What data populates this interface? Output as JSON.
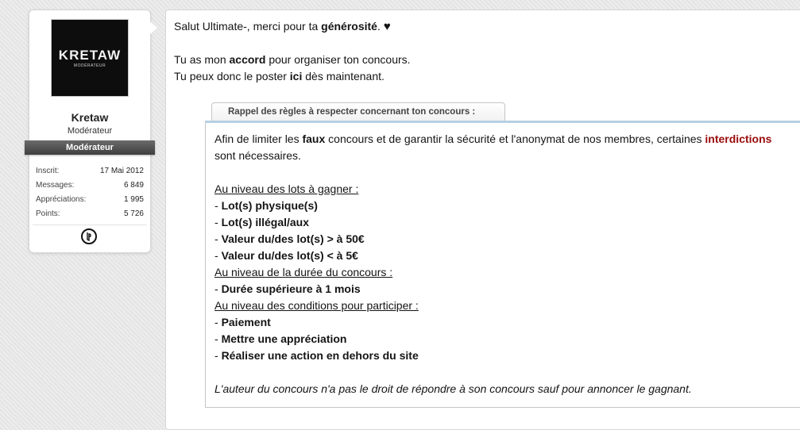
{
  "user": {
    "avatar_logo": "KRETAW",
    "avatar_sub": "MODÉRATEUR",
    "username": "Kretaw",
    "title": "Modérateur",
    "rank": "Modérateur",
    "stats": [
      {
        "label": "Inscrit:",
        "value": "17 Mai 2012"
      },
      {
        "label": "Messages:",
        "value": "6 849"
      },
      {
        "label": "Appréciations:",
        "value": "1 995"
      },
      {
        "label": "Points:",
        "value": "5 726"
      }
    ],
    "platform_icon": "playstation-icon"
  },
  "message": {
    "line1_a": "Salut Ultimate-, merci pour ta ",
    "line1_b": "générosité",
    "line1_c": ".",
    "heart": "♥",
    "line2_a": "Tu as mon ",
    "line2_b": "accord",
    "line2_c": " pour organiser ton concours.",
    "line3_a": "Tu peux donc le poster ",
    "line3_b": "ici",
    "line3_c": " dès maintenant."
  },
  "rules": {
    "tab_label": "Rappel des règles à respecter concernant ton concours :",
    "intro_a": "Afin de limiter les ",
    "intro_b": "faux",
    "intro_c": " concours et de garantir la sécurité et l'anonymat de nos membres, certaines ",
    "intro_d": "interdictions",
    "intro_e": "sont nécessaires.",
    "section_lots": "Au niveau des lots à gagner :",
    "lots": [
      "Lot(s) physique(s)",
      "Lot(s) illégal/aux",
      "Valeur du/des lot(s) > à 50€",
      "Valeur du/des lot(s) < à 5€"
    ],
    "section_duree": "Au niveau de la durée du concours :",
    "duree": [
      "Durée supérieure à 1 mois"
    ],
    "section_conditions": "Au niveau des conditions pour participer :",
    "conditions": [
      "Paiement",
      "Mettre une appréciation",
      "Réaliser une action en dehors du site"
    ],
    "dash": "- ",
    "footer": "L'auteur du concours n'a pas le droit de répondre à son concours sauf pour annoncer le gagnant."
  }
}
